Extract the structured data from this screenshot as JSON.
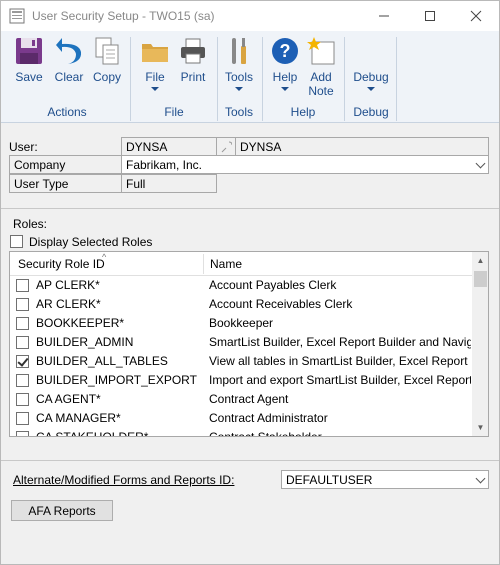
{
  "window": {
    "title": "User Security Setup  -  TWO15 (sa)",
    "minimize": "—",
    "maximize": "☐",
    "close": "✕"
  },
  "ribbon": {
    "buttons": {
      "save": "Save",
      "clear": "Clear",
      "copy": "Copy",
      "file": "File",
      "print": "Print",
      "tools": "Tools",
      "help": "Help",
      "add_note_line1": "Add",
      "add_note_line2": "Note",
      "debug": "Debug"
    },
    "groups": {
      "actions": "Actions",
      "file": "File",
      "tools": "Tools",
      "help": "Help",
      "debug": "Debug"
    }
  },
  "form": {
    "user_label": "User:",
    "user_id": "DYNSA",
    "user_name": "DYNSA",
    "company_label": "Company",
    "company_value": "Fabrikam, Inc.",
    "user_type_label": "User Type",
    "user_type_value": "Full",
    "roles_label": "Roles:",
    "display_selected_label": "Display Selected Roles",
    "display_selected_checked": false
  },
  "roles_grid": {
    "headers": {
      "id": "Security Role ID",
      "name": "Name"
    },
    "rows": [
      {
        "id": "AP CLERK*",
        "name": "Account Payables Clerk",
        "checked": false
      },
      {
        "id": "AR CLERK*",
        "name": "Account Receivables Clerk",
        "checked": false
      },
      {
        "id": "BOOKKEEPER*",
        "name": "Bookkeeper",
        "checked": false
      },
      {
        "id": "BUILDER_ADMIN",
        "name": "SmartList Builder, Excel Report Builder and Naviga",
        "checked": false
      },
      {
        "id": "BUILDER_ALL_TABLES",
        "name": "View all tables in SmartList Builder, Excel Report",
        "checked": true
      },
      {
        "id": "BUILDER_IMPORT_EXPORT",
        "name": "Import and export SmartList Builder, Excel Report",
        "checked": false
      },
      {
        "id": "CA AGENT*",
        "name": "Contract Agent",
        "checked": false
      },
      {
        "id": "CA MANAGER*",
        "name": "Contract Administrator",
        "checked": false
      },
      {
        "id": "CA STAKEHOLDER*",
        "name": "Contract Stakeholder",
        "checked": false
      }
    ]
  },
  "afa": {
    "label": "Alternate/Modified Forms and Reports ID:",
    "value": "DEFAULTUSER",
    "button": "AFA Reports"
  },
  "colors": {
    "ribbon_bg": "#eff3f8",
    "ribbon_text": "#1f4e8c",
    "window_bg": "#f0f0f0"
  }
}
